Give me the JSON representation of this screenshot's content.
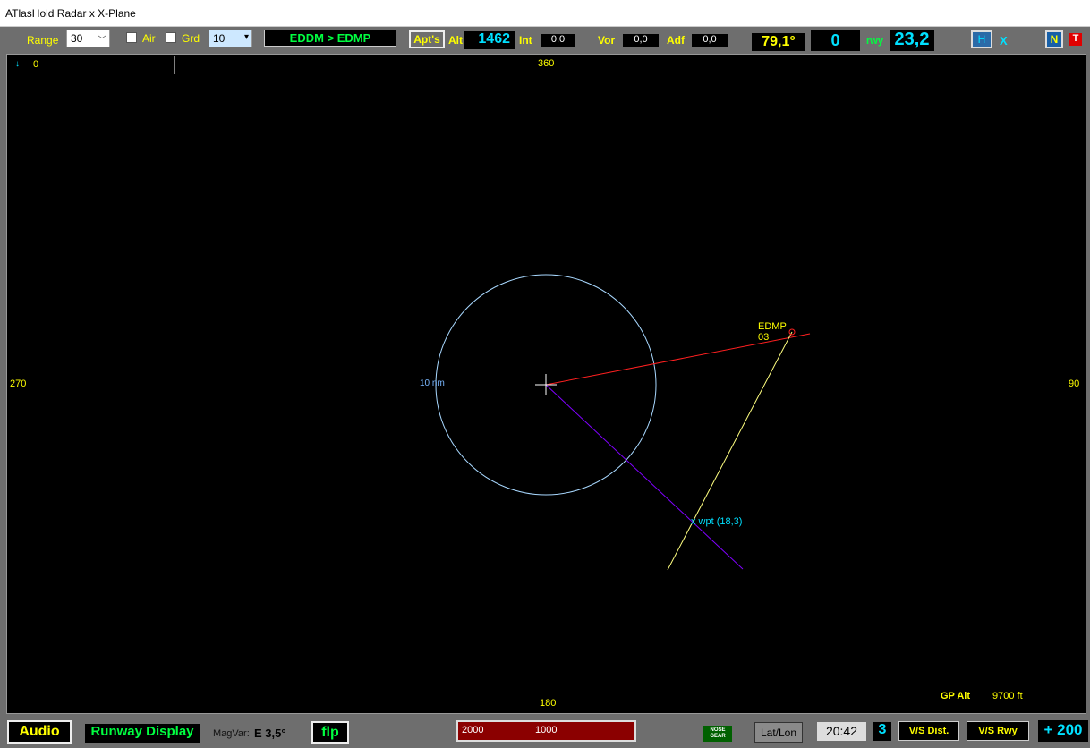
{
  "window": {
    "title": "ATlasHold Radar x X-Plane"
  },
  "toolbar": {
    "range_label": "Range",
    "range_value": "30",
    "air_label": "Air",
    "grd_label": "Grd",
    "grd_value": "10",
    "route": "EDDM > EDMP",
    "apts_label": "Apt's",
    "alt_label": "Alt",
    "alt_value": "1462",
    "int_label": "Int",
    "int_value": "0,0",
    "vor_label": "Vor",
    "vor_value": "0,0",
    "adf_label": "Adf",
    "adf_value": "0,0",
    "heading_value": "79,1°",
    "counter_value": "0",
    "rwy_label": "rwy",
    "rwy_value": "23,2",
    "h_label": "H",
    "x_label": "X",
    "n_label": "N",
    "t_label": "T"
  },
  "radar": {
    "north_arrow": "↓",
    "zero_label": "0",
    "hdg_top": "360",
    "hdg_right": "90",
    "hdg_bottom": "180",
    "hdg_left": "270",
    "ring_label": "10 nm",
    "airport_code": "EDMP",
    "runway_code": "03",
    "waypoint_label": "x wpt (18,3)",
    "gp_alt_label": "GP Alt",
    "gp_alt_value": "9700 ft",
    "colors": {
      "ring": "#a8d8ff",
      "course": "#ff2020",
      "approach": "#ffff80",
      "waypoint_line": "#8000ff",
      "heading_labels": "#ffff00"
    }
  },
  "bottom": {
    "audio_label": "Audio",
    "runway_display_label": "Runway Display",
    "magvar_label": "MagVar:",
    "magvar_value": "E 3,5°",
    "flp_label": "flp",
    "gauge_left": "2000",
    "gauge_right": "1000",
    "nose_gear_label": "NOSE GEAR",
    "latlon_label": "Lat/Lon",
    "time_value": "20:42",
    "counter2_value": "3",
    "vs_dist_label": "V/S Dist.",
    "vs_rwy_label": "V/S Rwy",
    "vs_value": "+ 200"
  }
}
